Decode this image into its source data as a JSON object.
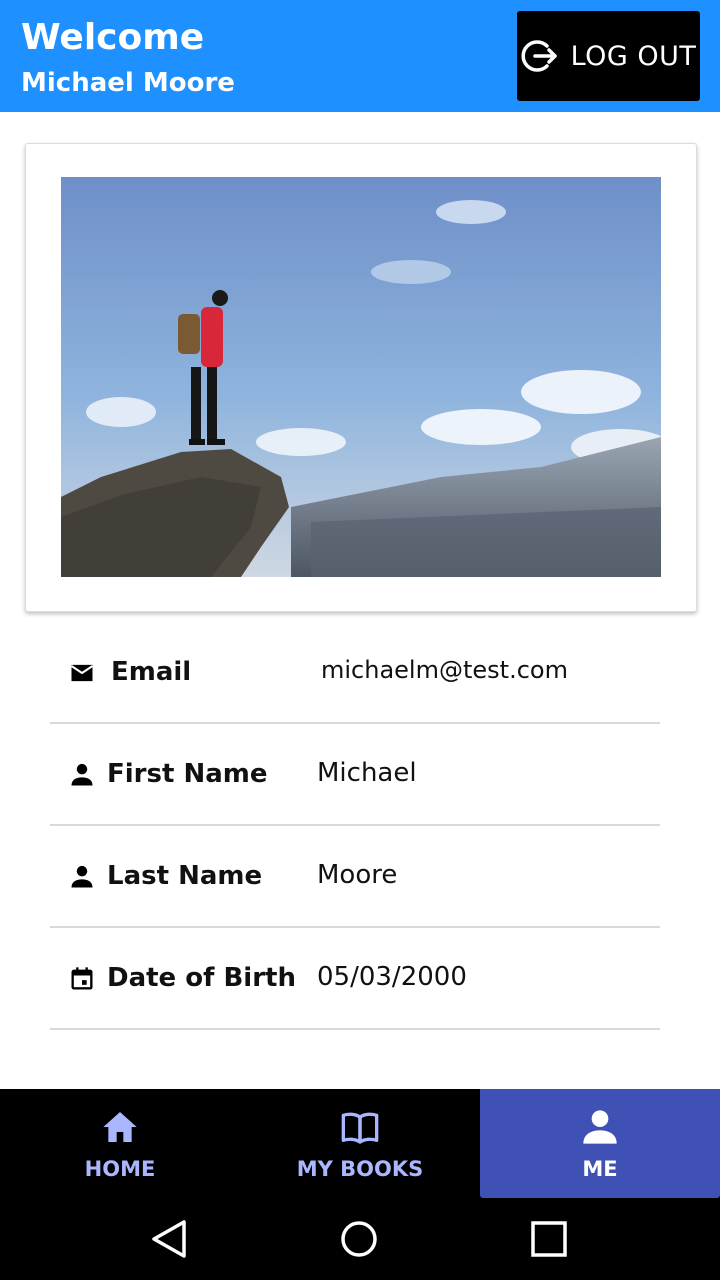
{
  "header": {
    "welcome": "Welcome",
    "username": "Michael Moore",
    "logout_label": "LOG OUT",
    "logout_icon": "logout-icon",
    "color": "#1e90ff"
  },
  "profile": {
    "photo": "hiker-on-cliff-photo",
    "fields": [
      {
        "label": "Email",
        "value": "michaelm@test.com",
        "icon": "email-icon"
      },
      {
        "label": "First Name",
        "value": "Michael",
        "icon": "person-icon"
      },
      {
        "label": "Last Name",
        "value": "Moore",
        "icon": "person-icon"
      },
      {
        "label": "Date of Birth",
        "value": "05/03/2000",
        "icon": "calendar-icon"
      }
    ]
  },
  "nav": {
    "items": [
      {
        "label": "HOME",
        "icon": "home-icon",
        "active": false
      },
      {
        "label": "MY BOOKS",
        "icon": "book-icon",
        "active": false
      },
      {
        "label": "ME",
        "icon": "person-icon",
        "active": true
      }
    ],
    "active_color": "#3f51b5"
  },
  "system_bar": {
    "icons": [
      "back-icon",
      "home-circle-icon",
      "recents-icon"
    ]
  }
}
